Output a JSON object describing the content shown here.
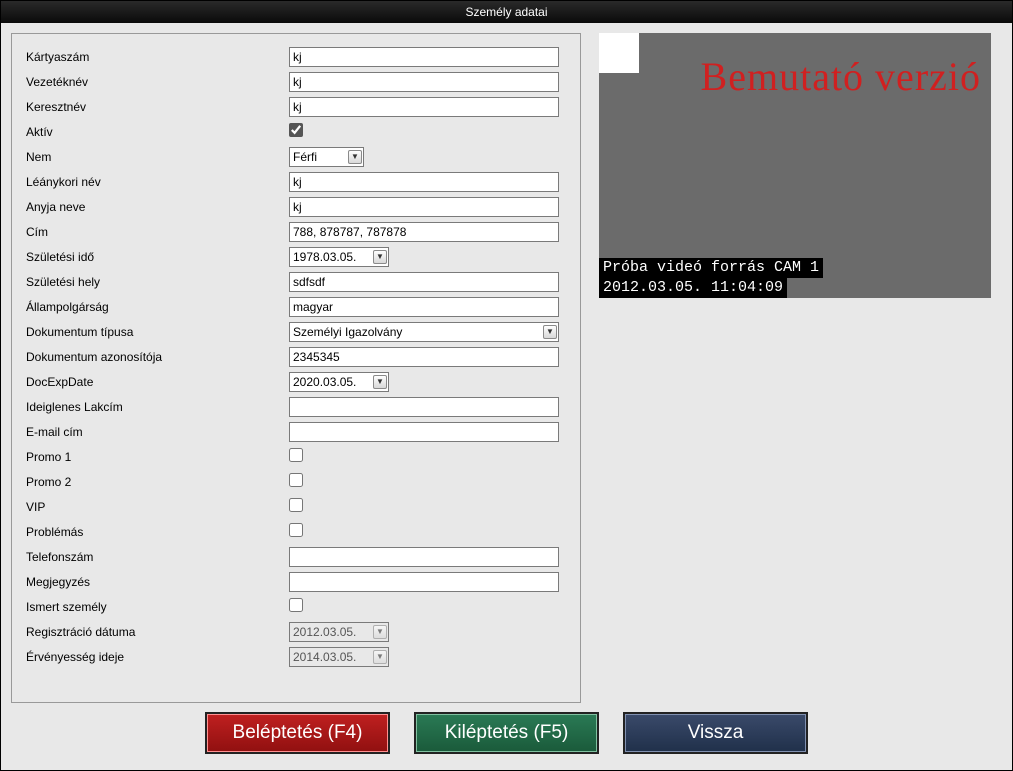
{
  "title": "Személy adatai",
  "form": {
    "cardnum": {
      "label": "Kártyaszám",
      "value": "kj"
    },
    "lastname": {
      "label": "Vezetéknév",
      "value": "kj"
    },
    "firstname": {
      "label": "Keresztnév",
      "value": "kj"
    },
    "active": {
      "label": "Aktív",
      "checked": true
    },
    "gender": {
      "label": "Nem",
      "value": "Férfi"
    },
    "maidenname": {
      "label": "Léánykori név",
      "value": "kj"
    },
    "mothersname": {
      "label": "Anyja neve",
      "value": "kj"
    },
    "address": {
      "label": "Cím",
      "value": "788, 878787, 787878"
    },
    "birthdate": {
      "label": "Születési idő",
      "value": "1978.03.05."
    },
    "birthplace": {
      "label": "Születési hely",
      "value": "sdfsdf"
    },
    "citizenship": {
      "label": "Állampolgárság",
      "value": "magyar"
    },
    "doctype": {
      "label": "Dokumentum típusa",
      "value": "Személyi Igazolvány"
    },
    "docid": {
      "label": "Dokumentum azonosítója",
      "value": "2345345"
    },
    "docexp": {
      "label": "DocExpDate",
      "value": "2020.03.05."
    },
    "tempaddr": {
      "label": "Ideiglenes Lakcím",
      "value": ""
    },
    "email": {
      "label": "E-mail cím",
      "value": ""
    },
    "promo1": {
      "label": "Promo 1",
      "checked": false
    },
    "promo2": {
      "label": "Promo 2",
      "checked": false
    },
    "vip": {
      "label": "VIP",
      "checked": false
    },
    "problematic": {
      "label": "Problémás",
      "checked": false
    },
    "phone": {
      "label": "Telefonszám",
      "value": ""
    },
    "note": {
      "label": "Megjegyzés",
      "value": ""
    },
    "known": {
      "label": "Ismert személy",
      "checked": false
    },
    "regdate": {
      "label": "Regisztráció dátuma",
      "value": "2012.03.05."
    },
    "validuntil": {
      "label": "Érvényesség ideje",
      "value": "2014.03.05."
    }
  },
  "video": {
    "watermark": "Bemutató verzió",
    "line1": "Próba videó forrás CAM 1",
    "line2": "2012.03.05. 11:04:09"
  },
  "buttons": {
    "checkin": "Beléptetés (F4)",
    "checkout": "Kiléptetés (F5)",
    "back": "Vissza"
  }
}
